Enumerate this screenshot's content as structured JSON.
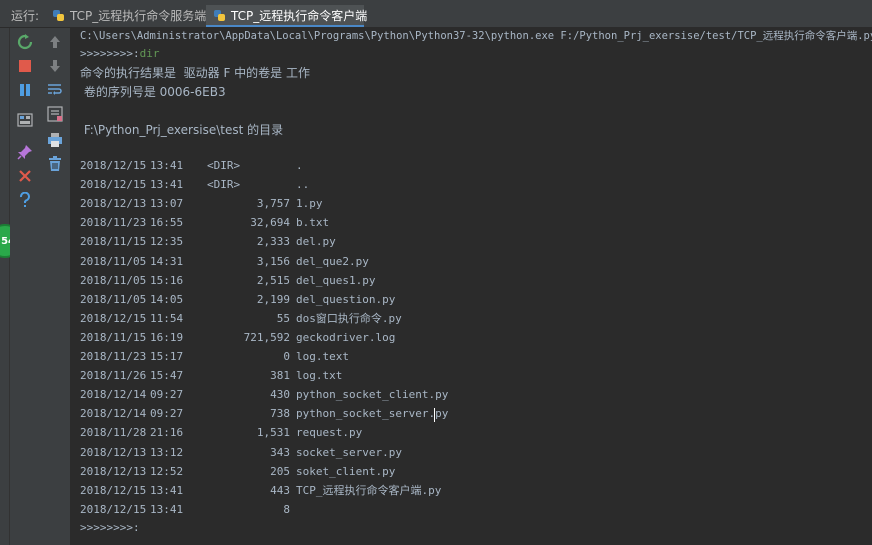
{
  "run_label": "运行:",
  "tabs": [
    {
      "label": "TCP_远程执行命令服务端",
      "active": false
    },
    {
      "label": "TCP_远程执行命令客户端",
      "active": true
    }
  ],
  "toolbar_left": [
    "rerun-icon",
    "stop-icon",
    "pause-icon",
    "layout-icon",
    "pin-icon",
    "close-icon",
    "help-icon"
  ],
  "toolbar_right": [
    "up-arrow-icon",
    "down-arrow-icon",
    "soft-wrap-icon",
    "scroll-to-end-icon",
    "print-icon",
    "trash-icon"
  ],
  "badge_text": "54",
  "console": {
    "command_line": "C:\\Users\\Administrator\\AppData\\Local\\Programs\\Python\\Python37-32\\python.exe F:/Python_Prj_exersise/test/TCP_远程执行命令客户端.py",
    "prompt": ">>>>>>>>:",
    "input_text": "dir",
    "result_header": "命令的执行结果是  驱动器 F 中的卷是 工作",
    "serial_line": " 卷的序列号是 0006-6EB3",
    "dir_line": " F:\\Python_Prj_exersise\\test 的目录",
    "entries": [
      {
        "date": "2018/12/15",
        "time": "13:41",
        "dir": "<DIR>",
        "size": "",
        "name": "."
      },
      {
        "date": "2018/12/15",
        "time": "13:41",
        "dir": "<DIR>",
        "size": "",
        "name": ".."
      },
      {
        "date": "2018/12/13",
        "time": "13:07",
        "dir": "",
        "size": "3,757",
        "name": "1.py"
      },
      {
        "date": "2018/11/23",
        "time": "16:55",
        "dir": "",
        "size": "32,694",
        "name": "b.txt"
      },
      {
        "date": "2018/11/15",
        "time": "12:35",
        "dir": "",
        "size": "2,333",
        "name": "del.py"
      },
      {
        "date": "2018/11/05",
        "time": "14:31",
        "dir": "",
        "size": "3,156",
        "name": "del_que2.py"
      },
      {
        "date": "2018/11/05",
        "time": "15:16",
        "dir": "",
        "size": "2,515",
        "name": "del_ques1.py"
      },
      {
        "date": "2018/11/05",
        "time": "14:05",
        "dir": "",
        "size": "2,199",
        "name": "del_question.py"
      },
      {
        "date": "2018/12/15",
        "time": "11:54",
        "dir": "",
        "size": "55",
        "name": "dos窗口执行命令.py"
      },
      {
        "date": "2018/11/15",
        "time": "16:19",
        "dir": "",
        "size": "721,592",
        "name": "geckodriver.log"
      },
      {
        "date": "2018/11/23",
        "time": "15:17",
        "dir": "",
        "size": "0",
        "name": "log.text"
      },
      {
        "date": "2018/11/26",
        "time": "15:47",
        "dir": "",
        "size": "381",
        "name": "log.txt"
      },
      {
        "date": "2018/12/14",
        "time": "09:27",
        "dir": "",
        "size": "430",
        "name": "python_socket_client.py"
      },
      {
        "date": "2018/12/14",
        "time": "09:27",
        "dir": "",
        "size": "738",
        "name": "python_socket_server.py"
      },
      {
        "date": "2018/11/28",
        "time": "21:16",
        "dir": "",
        "size": "1,531",
        "name": "request.py"
      },
      {
        "date": "2018/12/13",
        "time": "13:12",
        "dir": "",
        "size": "343",
        "name": "socket_server.py"
      },
      {
        "date": "2018/12/13",
        "time": "12:52",
        "dir": "",
        "size": "205",
        "name": "soket_client.py"
      },
      {
        "date": "2018/12/15",
        "time": "13:41",
        "dir": "",
        "size": "443",
        "name": "TCP_远程执行命令客户端.py"
      },
      {
        "date": "2018/12/15",
        "time": "13:41",
        "dir": "",
        "size": "8",
        "name": ""
      }
    ],
    "final_prompt": ">>>>>>>>:"
  }
}
